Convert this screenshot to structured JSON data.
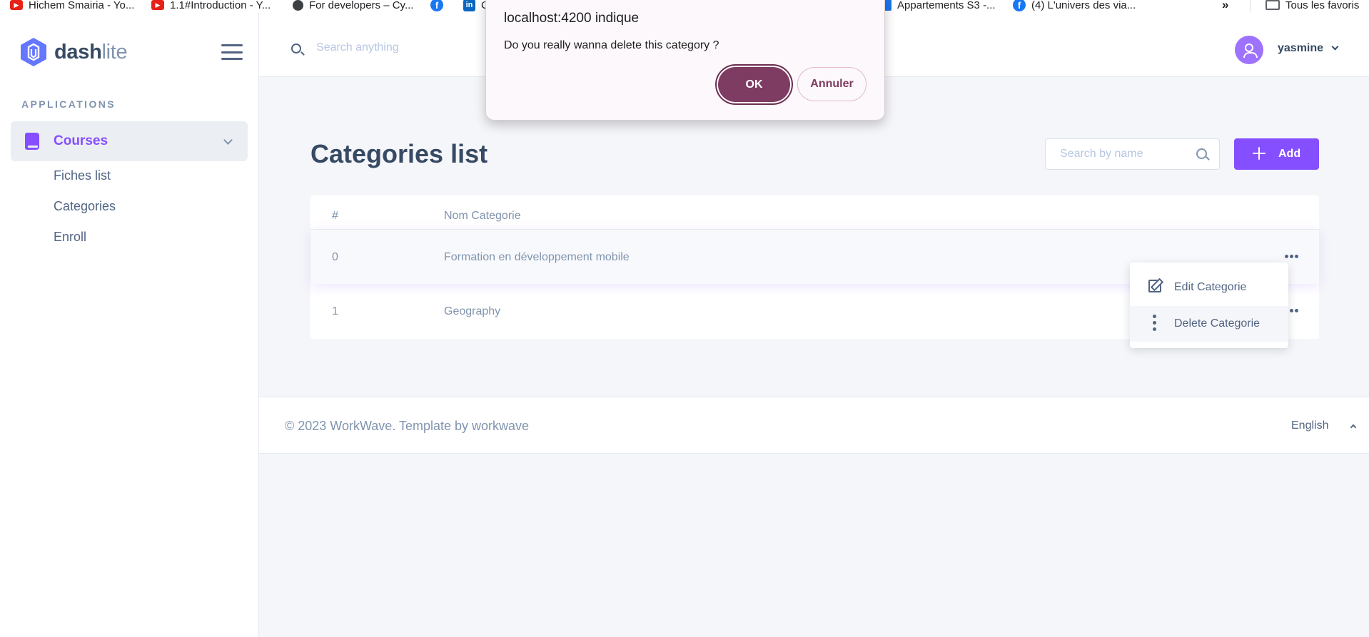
{
  "bookmarks": [
    {
      "label": "Hichem Smairia - Yo...",
      "icon": "youtube-icon"
    },
    {
      "label": "1.1#Introduction - Y...",
      "icon": "youtube-icon"
    },
    {
      "label": "For developers – Cy...",
      "icon": "globe-icon"
    },
    {
      "label": "",
      "icon": "facebook-icon"
    },
    {
      "label": "C",
      "icon": "linkedin-icon"
    },
    {
      "label": "Appartements S3 -...",
      "icon": "doc-icon"
    },
    {
      "label": "(4) L'univers des via...",
      "icon": "facebook-icon"
    }
  ],
  "bookmarks_more": "»",
  "bookmarks_all": "Tous les favoris",
  "sidebar": {
    "logo_main": "dash",
    "logo_accent": "lite",
    "section_heading": "APPLICATIONS",
    "course_label": "Courses",
    "sub_items": [
      "Fiches list",
      "Categories",
      "Enroll"
    ]
  },
  "header": {
    "search_placeholder": "Search anything",
    "user_name": "yasmine"
  },
  "main": {
    "title": "Categories list",
    "search_placeholder": "Search by name",
    "add_label": "Add",
    "columns": [
      "#",
      "Nom Categorie"
    ],
    "rows": [
      {
        "index": "0",
        "name": "Formation en développement mobile"
      },
      {
        "index": "1",
        "name": "Geography"
      }
    ]
  },
  "dropdown": {
    "edit_label": "Edit Categorie",
    "delete_label": "Delete Categorie"
  },
  "footer": {
    "copyright": "© 2023 WorkWave. Template by workwave",
    "language": "English"
  },
  "dialog": {
    "title": "localhost:4200 indique",
    "message": "Do you really wanna delete this category ?",
    "ok_label": "OK",
    "cancel_label": "Annuler"
  },
  "colors": {
    "accent": "#854fff",
    "dialog_button": "#7e3c62",
    "text_primary": "#364a63",
    "text_muted": "#8094ae"
  }
}
